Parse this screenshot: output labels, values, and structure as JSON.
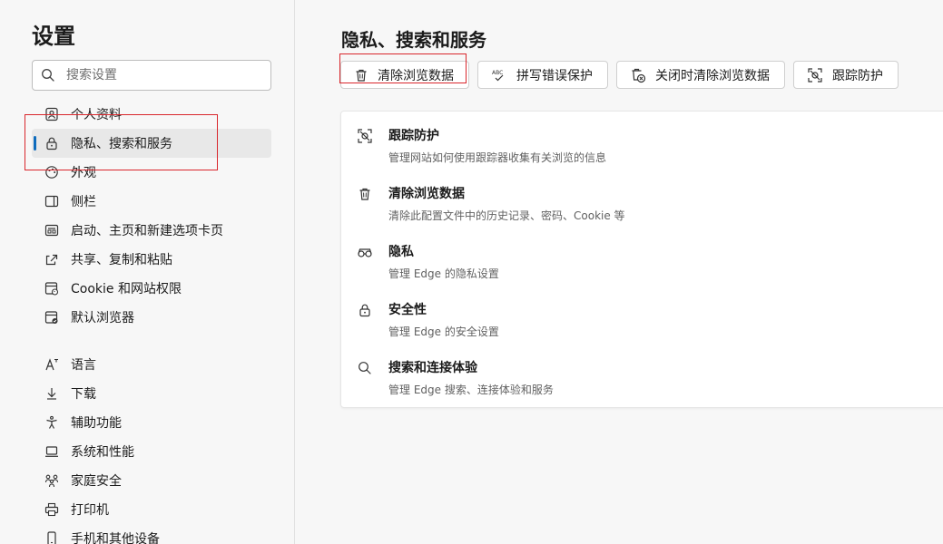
{
  "sidebar": {
    "title": "设置",
    "search_placeholder": "搜索设置",
    "items": [
      {
        "label": "个人资料",
        "icon": "profile-icon"
      },
      {
        "label": "隐私、搜索和服务",
        "icon": "lock-icon",
        "active": true
      },
      {
        "label": "外观",
        "icon": "appearance-icon"
      },
      {
        "label": "侧栏",
        "icon": "sidebar-icon"
      },
      {
        "label": "启动、主页和新建选项卡页",
        "icon": "home-icon"
      },
      {
        "label": "共享、复制和粘贴",
        "icon": "share-icon"
      },
      {
        "label": "Cookie 和网站权限",
        "icon": "cookie-icon"
      },
      {
        "label": "默认浏览器",
        "icon": "browser-icon"
      },
      {
        "label": "语言",
        "icon": "language-icon"
      },
      {
        "label": "下载",
        "icon": "download-icon"
      },
      {
        "label": "辅助功能",
        "icon": "accessibility-icon"
      },
      {
        "label": "系统和性能",
        "icon": "laptop-icon"
      },
      {
        "label": "家庭安全",
        "icon": "family-icon"
      },
      {
        "label": "打印机",
        "icon": "printer-icon"
      },
      {
        "label": "手机和其他设备",
        "icon": "phone-icon"
      }
    ]
  },
  "main": {
    "title": "隐私、搜索和服务",
    "pills": [
      {
        "label": "清除浏览数据",
        "icon": "trash-icon"
      },
      {
        "label": "拼写错误保护",
        "icon": "spellcheck-icon"
      },
      {
        "label": "关闭时清除浏览数据",
        "icon": "trash-clock-icon"
      },
      {
        "label": "跟踪防护",
        "icon": "tracking-icon"
      }
    ],
    "rows": [
      {
        "title": "跟踪防护",
        "desc": "管理网站如何使用跟踪器收集有关浏览的信息",
        "icon": "tracking-icon"
      },
      {
        "title": "清除浏览数据",
        "desc": "清除此配置文件中的历史记录、密码、Cookie 等",
        "icon": "trash-icon"
      },
      {
        "title": "隐私",
        "desc": "管理 Edge 的隐私设置",
        "icon": "glasses-icon"
      },
      {
        "title": "安全性",
        "desc": "管理 Edge 的安全设置",
        "icon": "lock-icon"
      },
      {
        "title": "搜索和连接体验",
        "desc": "管理 Edge 搜索、连接体验和服务",
        "icon": "search-icon"
      }
    ]
  },
  "colors": {
    "accent": "#0f6cbd",
    "annotation": "#d9262c"
  }
}
